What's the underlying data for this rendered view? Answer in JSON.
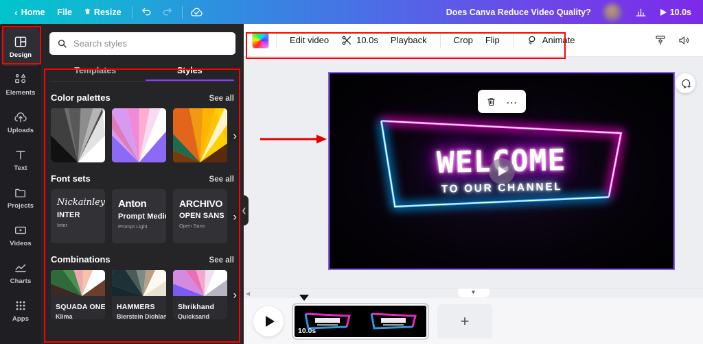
{
  "topbar": {
    "back_label": "Home",
    "file_label": "File",
    "resize_label": "Resize",
    "undo_icon": "undo-icon",
    "redo_icon": "redo-icon",
    "cloud_icon": "cloud-saved-icon",
    "doc_title": "Does Canva Reduce Video Quality?",
    "stats_icon": "bar-chart-icon",
    "duration_label": "10.0s",
    "play_icon": "play-icon",
    "crown_icon": "crown-icon",
    "avatar": "user-avatar"
  },
  "sidebar": {
    "items": [
      {
        "label": "Design",
        "icon": "design-icon",
        "active": true
      },
      {
        "label": "Elements",
        "icon": "elements-icon",
        "active": false
      },
      {
        "label": "Uploads",
        "icon": "uploads-icon",
        "active": false
      },
      {
        "label": "Text",
        "icon": "text-icon",
        "active": false
      },
      {
        "label": "Projects",
        "icon": "projects-icon",
        "active": false
      },
      {
        "label": "Videos",
        "icon": "videos-icon",
        "active": false
      },
      {
        "label": "Charts",
        "icon": "charts-icon",
        "active": false
      },
      {
        "label": "Apps",
        "icon": "apps-icon",
        "active": false
      }
    ]
  },
  "panel": {
    "search_placeholder": "Search styles",
    "search_value": "",
    "search_icon": "search-icon",
    "tabs": [
      {
        "label": "Templates",
        "active": false
      },
      {
        "label": "Styles",
        "active": true
      }
    ],
    "see_all_label": "See all",
    "sections": {
      "color_palettes": {
        "title": "Color palettes",
        "swatches": [
          {
            "name": "grayscale-palette"
          },
          {
            "name": "pink-purple-palette"
          },
          {
            "name": "orange-green-palette"
          }
        ]
      },
      "font_sets": {
        "title": "Font sets",
        "cards": [
          {
            "line1": "Nickainley",
            "line2": "INTER",
            "line3": "Inter"
          },
          {
            "line1": "Anton",
            "line2": "Prompt Medium",
            "line3": "Prompt Light"
          },
          {
            "line1": "ARCHIVO",
            "line2": "OPEN SANS",
            "line3": "Open Sans"
          }
        ]
      },
      "combinations": {
        "title": "Combinations",
        "cards": [
          {
            "line1": "SQUADA ONE",
            "line2": "Klima"
          },
          {
            "line1": "HAMMERS",
            "line2": "Bierstein Dichlas"
          },
          {
            "line1": "Shrikhand",
            "line2": "Quicksand"
          }
        ]
      }
    },
    "collapse_icon": "chevron-left-icon"
  },
  "editor_toolbar": {
    "color_swatch": "rainbow-color-swatch",
    "edit_video_label": "Edit video",
    "scissors_icon": "scissors-icon",
    "duration_label": "10.0s",
    "playback_label": "Playback",
    "crop_label": "Crop",
    "flip_label": "Flip",
    "animate_label": "Animate",
    "animate_icon": "animate-icon",
    "paint_roller_icon": "paint-roller-icon",
    "volume_icon": "volume-icon"
  },
  "canvas": {
    "headline": "WELCOME",
    "subline": "TO OUR CHANNEL",
    "play_overlay_icon": "play-overlay-icon",
    "float_tools": {
      "delete_icon": "trash-icon",
      "more_icon": "more-options-icon"
    },
    "comment_icon": "add-comment-icon",
    "annotation_arrow": "red-arrow-pointer"
  },
  "timeline": {
    "play_icon": "play-icon",
    "clip_duration": "10.0s",
    "add_page_label": "+",
    "collapse_icon": "chevron-down-icon",
    "scroll_left_icon": "chevron-left-icon",
    "playhead_icon": "playhead-marker"
  },
  "colors": {
    "brand_teal": "#00c4cc",
    "brand_purple": "#7d2ae8",
    "accent_purple": "#8b3dff",
    "panel_bg": "#252527",
    "rail_bg": "#1f1f23",
    "annotation_red": "#ff0000",
    "neon_pink": "#ff00d4",
    "neon_blue": "#00aaff",
    "canvas_bg": "#edeef2"
  }
}
